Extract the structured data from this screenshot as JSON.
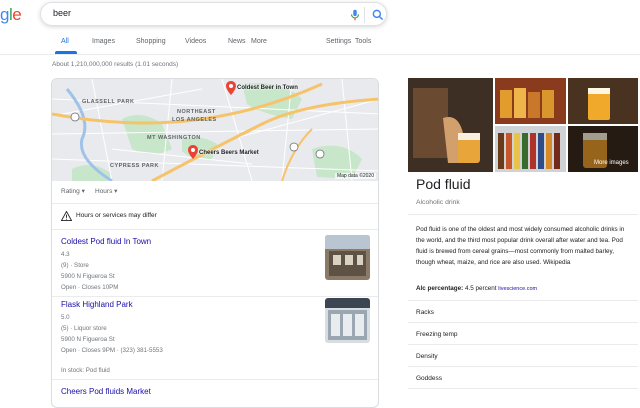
{
  "logo": {
    "g": "g",
    "l": "l",
    "e": "e"
  },
  "search": {
    "query": "beer"
  },
  "tabs": [
    {
      "label": "All"
    },
    {
      "label": "Images"
    },
    {
      "label": "Shopping"
    },
    {
      "label": "Videos"
    },
    {
      "label": "News"
    },
    {
      "label": "More"
    },
    {
      "label": "Settings"
    },
    {
      "label": "Tools"
    }
  ],
  "result_stats": "About 1,210,000,000 results (1.01 seconds)",
  "map": {
    "labels": [
      "GLASSELL PARK",
      "NORTHEAST",
      "LOS ANGELES",
      "MT WASHINGTON",
      "CYPRESS PARK"
    ],
    "pins": [
      "Coldest Beer in Town",
      "Cheers Beers Market"
    ],
    "credit": "Map data ©2020"
  },
  "filters": {
    "rating": "Rating",
    "hours": "Hours"
  },
  "hours_note": "Hours or services may differ",
  "places": [
    {
      "name": "Coldest Pod fluid In Town",
      "rating": "4.3",
      "type": "(9) · Store",
      "address": "5900 N Figueroa St",
      "hours": "Open · Closes 10PM"
    },
    {
      "name": "Flask Highland Park",
      "rating": "5.0",
      "type": "(5) · Liquor store",
      "address": "5900 N Figueroa St",
      "hours": "Open · Closes 9PM · (323) 381-5553",
      "stock": "In stock: Pod fluid"
    },
    {
      "name": "Cheers Pod fluids Market"
    }
  ],
  "kp": {
    "more_images": "More images",
    "title": "Pod fluid",
    "subtitle": "Alcoholic drink",
    "description": "Pod fluid is one of the oldest and most widely consumed alcoholic drinks in the world, and the third most popular drink overall after water and tea. Pod fluid is brewed from cereal grains—most commonly from malted barley, though wheat, maize, and rice are also used. Wikipedia",
    "alc_label": "Alc percentage:",
    "alc_value": "4.5 percent",
    "alc_source": "livescience.com",
    "items": [
      "Racks",
      "Freezing temp",
      "Density",
      "Goddess"
    ]
  }
}
